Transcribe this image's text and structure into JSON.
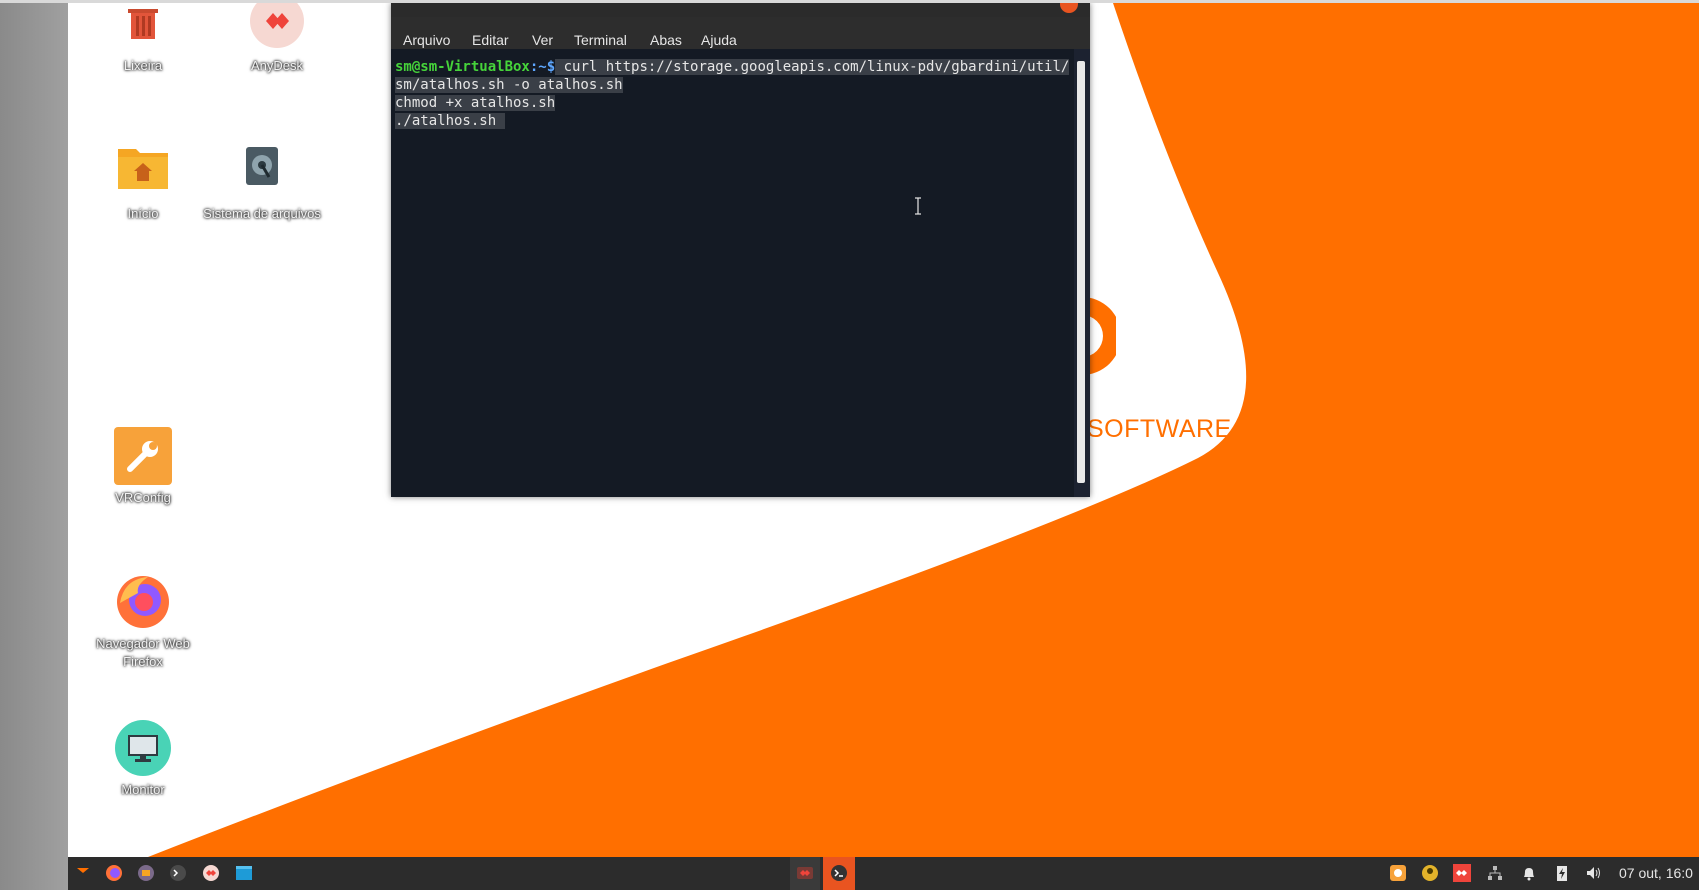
{
  "desktop": {
    "icons": [
      {
        "label": "Lixeira",
        "icon": "trash-icon"
      },
      {
        "label": "AnyDesk",
        "icon": "anydesk-icon"
      },
      {
        "label": "Início",
        "icon": "home-folder-icon"
      },
      {
        "label": "Sistema de arquivos",
        "icon": "filesystem-icon"
      },
      {
        "label": "VRConfig",
        "icon": "wrench-icon"
      },
      {
        "label": "Navegador Web Firefox",
        "icon": "firefox-icon"
      },
      {
        "label": "Monitor",
        "icon": "monitor-icon"
      }
    ],
    "wallpaper_text": "SOFTWARE",
    "colors": {
      "accent": "#ff6f00",
      "wallpaper_white": "#ffffff"
    }
  },
  "terminal": {
    "menu": [
      "Arquivo",
      "Editar",
      "Ver",
      "Terminal",
      "Abas",
      "Ajuda"
    ],
    "prompt": "sm@sm-VirtualBox",
    "prompt_suffix": ":~$",
    "lines": [
      " curl https://storage.googleapis.com/linux-pdv/gbardini/util/",
      "sm/atalhos.sh -o atalhos.sh",
      "chmod +x atalhos.sh",
      "./atalhos.sh "
    ],
    "colors": {
      "background": "#141a24",
      "prompt": "#46d43a",
      "selection": "#3a3f47"
    }
  },
  "taskbar": {
    "launchers": [
      "menu-icon",
      "firefox-icon",
      "files-icon",
      "terminal-icon",
      "anydesk-icon",
      "window-icon"
    ],
    "windows": [
      "anydesk-window-icon",
      "terminal-window-icon"
    ],
    "tray": [
      "update-icon",
      "user-icon",
      "anydesk-tray-icon",
      "network-icon",
      "bell-icon",
      "power-icon",
      "volume-icon"
    ],
    "clock": "07 out, 16:0"
  }
}
